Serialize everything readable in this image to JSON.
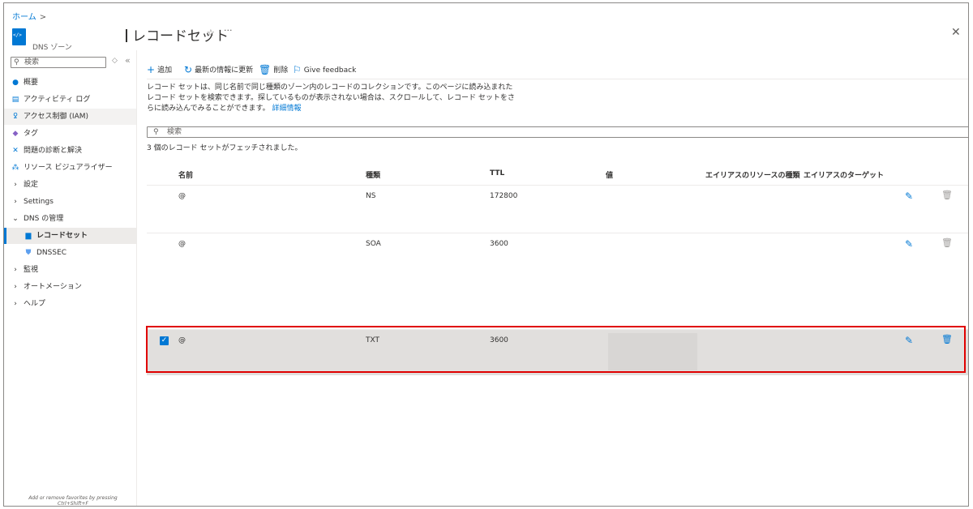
{
  "breadcrumb": {
    "home": "ホーム",
    "separator": ">"
  },
  "resource": {
    "type_label": "DNS ゾーン"
  },
  "header": {
    "title": "レコードセット",
    "favorite_icon": "☆",
    "more_icon": "···",
    "close_icon": "✕"
  },
  "sidebar": {
    "search_placeholder": "検索",
    "items": [
      {
        "icon": "overview-icon",
        "label": "概要"
      },
      {
        "icon": "activity-log-icon",
        "label": "アクティビティ ログ"
      },
      {
        "icon": "iam-icon",
        "label": "アクセス制御 (IAM)"
      },
      {
        "icon": "tag-icon",
        "label": "タグ"
      },
      {
        "icon": "diagnose-icon",
        "label": "問題の診断と解決"
      },
      {
        "icon": "resource-visualizer-icon",
        "label": "リソース ビジュアライザー"
      },
      {
        "icon": "chevron-right-icon",
        "label": "設定"
      },
      {
        "icon": "chevron-right-icon",
        "label": "Settings"
      },
      {
        "icon": "chevron-down-icon",
        "label": "DNS の管理"
      },
      {
        "icon": "recordset-icon",
        "label": "レコードセット"
      },
      {
        "icon": "dnssec-icon",
        "label": "DNSSEC"
      },
      {
        "icon": "chevron-right-icon",
        "label": "監視"
      },
      {
        "icon": "chevron-right-icon",
        "label": "オートメーション"
      },
      {
        "icon": "chevron-right-icon",
        "label": "ヘルプ"
      }
    ],
    "favorites_hint_line1": "Add or remove favorites by pressing",
    "favorites_hint_line2": "Ctrl+Shift+F"
  },
  "toolbar": {
    "add": "追加",
    "refresh": "最新の情報に更新",
    "delete": "削除",
    "feedback": "Give feedback"
  },
  "description": {
    "text": "レコード セットは、同じ名前で同じ種類のゾーン内のレコードのコレクションです。このページに読み込まれたレコード セットを検索できます。探しているものが表示されない場合は、スクロールして、レコード セットをさらに読み込んでみることができます。",
    "link": "詳細情報"
  },
  "filter": {
    "placeholder": "検索"
  },
  "count_text": "3 個のレコード セットがフェッチされました。",
  "table": {
    "columns": [
      "名前",
      "種類",
      "TTL",
      "値",
      "エイリアスのリソースの種類",
      "エイリアスのターゲット"
    ],
    "rows": [
      {
        "name": "@",
        "type": "NS",
        "ttl": "172800",
        "selected": false
      },
      {
        "name": "@",
        "type": "SOA",
        "ttl": "3600",
        "selected": false
      },
      {
        "name": "@",
        "type": "TXT",
        "ttl": "3600",
        "selected": true
      }
    ]
  },
  "colors": {
    "accent": "#0078d4",
    "highlight_border": "#e00000",
    "selected_row": "#e1dfdd"
  }
}
